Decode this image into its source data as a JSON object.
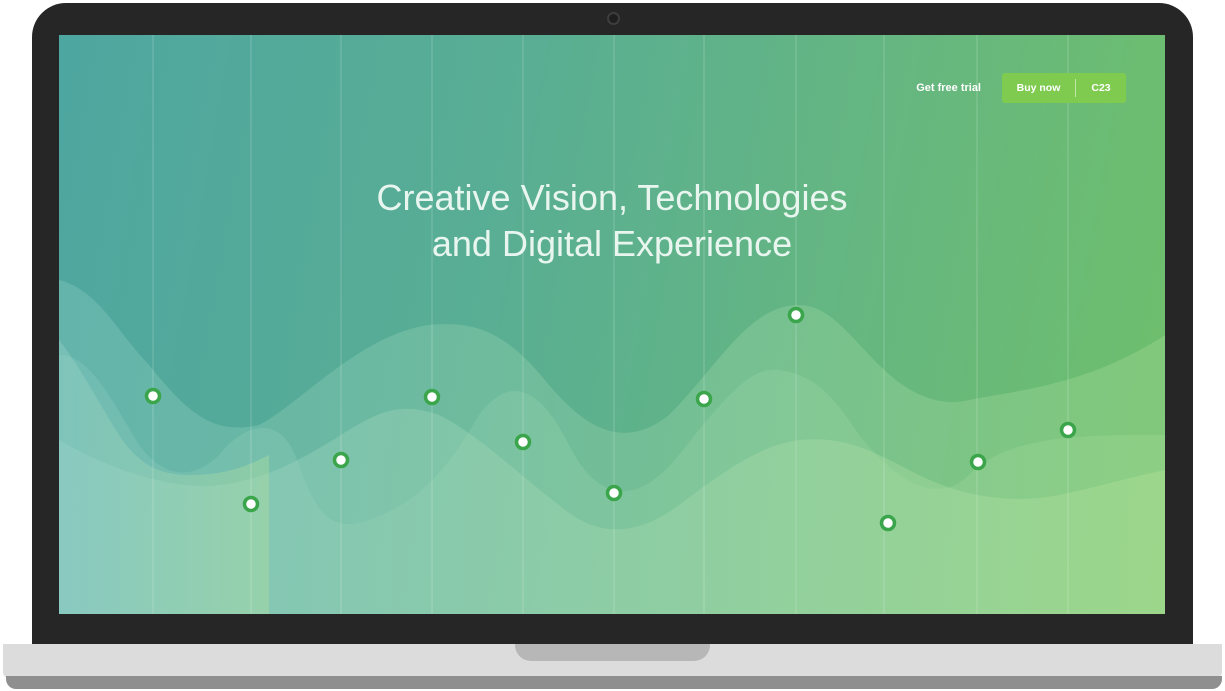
{
  "header": {
    "trial_label": "Get free trial",
    "buy_label": "Buy now",
    "buy_price": "C23"
  },
  "hero": {
    "title_line1": "Creative Vision, Technologies",
    "title_line2": "and Digital Experience"
  },
  "colors": {
    "gradient_start": "#4ea6a0",
    "gradient_end": "#6fbf6b",
    "button_accent": "#7ecb4f",
    "marker_ring": "#3aa54a"
  }
}
